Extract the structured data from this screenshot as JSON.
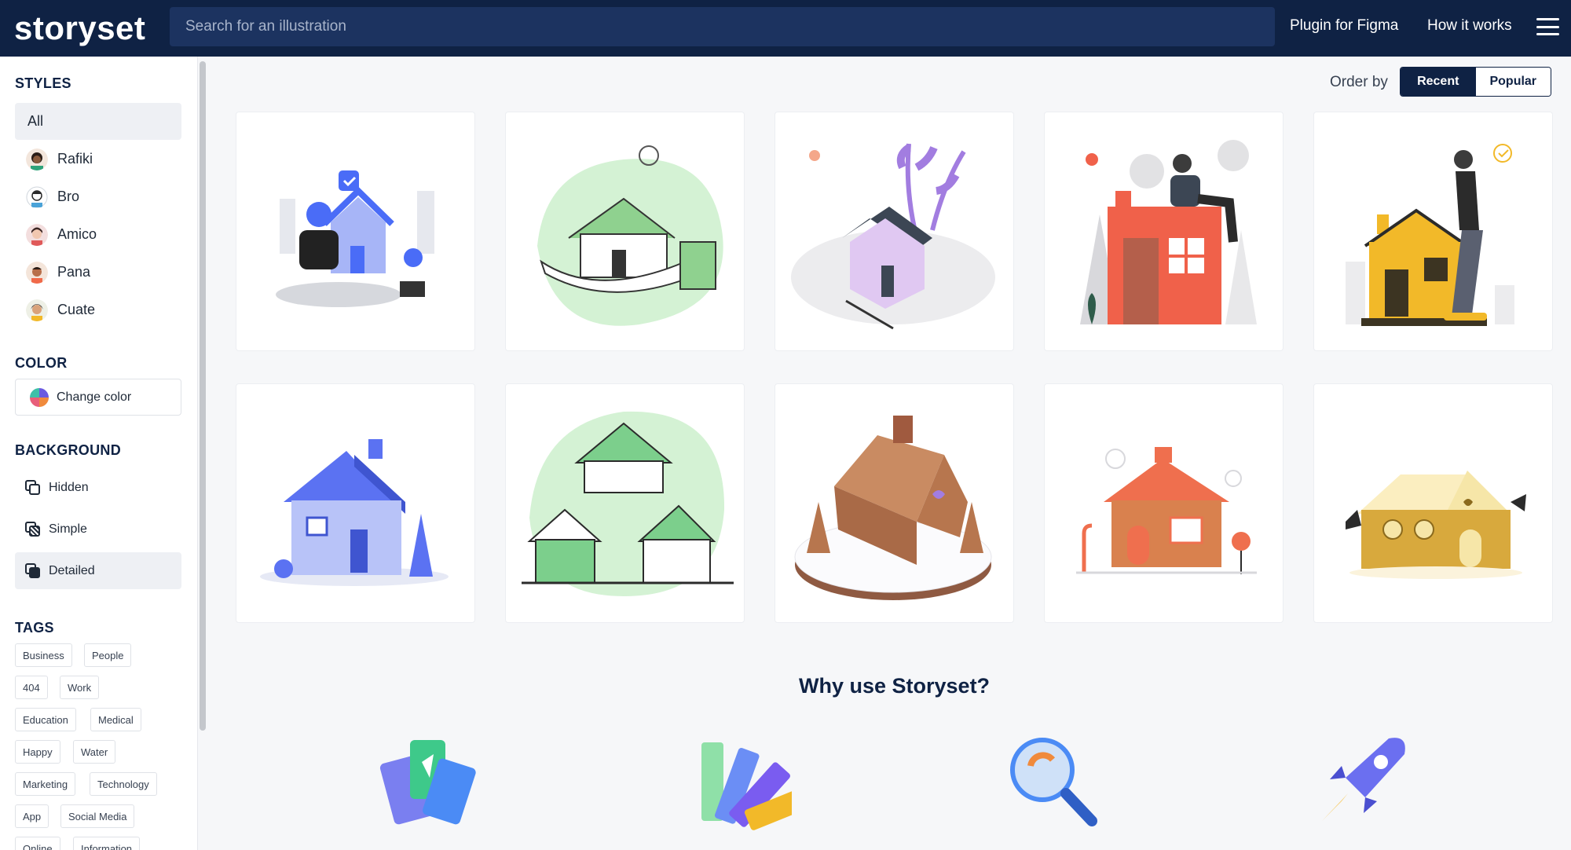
{
  "header": {
    "logo": "storyset",
    "search_placeholder": "Search for an illustration",
    "nav": {
      "figma": "Plugin for Figma",
      "how": "How it works"
    },
    "menu_icon": "hamburger-icon"
  },
  "sidebar": {
    "styles_title": "STYLES",
    "styles": [
      {
        "label": "All",
        "active": true
      },
      {
        "label": "Rafiki",
        "icon": "rafiki-avatar"
      },
      {
        "label": "Bro",
        "icon": "bro-avatar"
      },
      {
        "label": "Amico",
        "icon": "amico-avatar"
      },
      {
        "label": "Pana",
        "icon": "pana-avatar"
      },
      {
        "label": "Cuate",
        "icon": "cuate-avatar"
      }
    ],
    "color_title": "COLOR",
    "change_color": "Change color",
    "background_title": "BACKGROUND",
    "backgrounds": [
      {
        "label": "Hidden"
      },
      {
        "label": "Simple"
      },
      {
        "label": "Detailed",
        "active": true
      }
    ],
    "tags_title": "TAGS",
    "tags": [
      "Business",
      "People",
      "404",
      "Work",
      "Education",
      "Medical",
      "Happy",
      "Water",
      "Marketing",
      "Technology",
      "App",
      "Social Media",
      "Online",
      "Information"
    ]
  },
  "main": {
    "order_by_label": "Order by",
    "order_options": [
      "Recent",
      "Popular"
    ],
    "order_active": "Recent",
    "illustrations": [
      {
        "name": "woman-hugging-house",
        "accent": "#4a6cf7"
      },
      {
        "name": "hand-holding-house",
        "accent": "#8fd18f"
      },
      {
        "name": "purple-house-plants",
        "accent": "#a27de0"
      },
      {
        "name": "man-on-red-house",
        "accent": "#f0614a"
      },
      {
        "name": "man-leaning-yellow-house",
        "accent": "#f2b929"
      },
      {
        "name": "blue-winter-house",
        "accent": "#5b72f2"
      },
      {
        "name": "green-gingerbread-houses",
        "accent": "#7ccf8c"
      },
      {
        "name": "gingerbread-house-snow",
        "accent": "#b7764e"
      },
      {
        "name": "gingerbread-house-candy",
        "accent": "#ef6f4e"
      },
      {
        "name": "golden-gingerbread-house",
        "accent": "#d8a93d"
      }
    ],
    "why_title": "Why use Storyset?",
    "features": [
      "cards-icon",
      "palette-icon",
      "magnifier-icon",
      "rocket-icon"
    ]
  }
}
